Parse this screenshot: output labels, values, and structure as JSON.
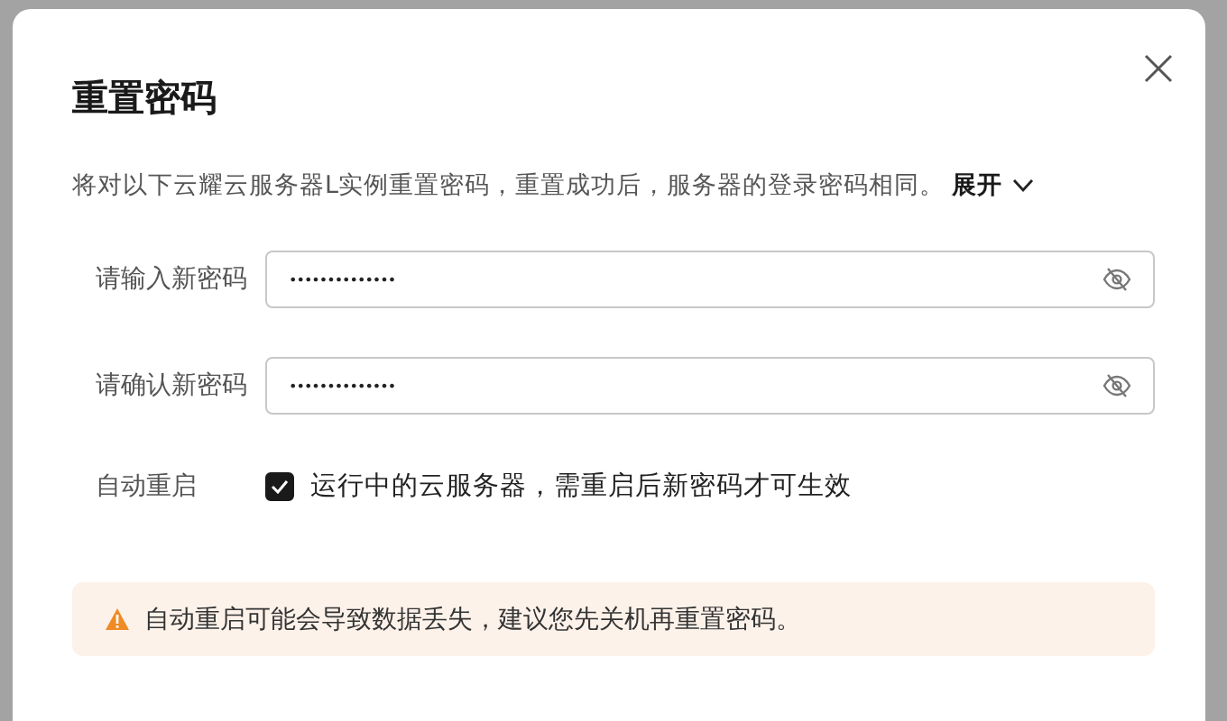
{
  "dialog": {
    "title": "重置密码",
    "description": "将对以下云耀云服务器L实例重置密码，重置成功后，服务器的登录密码相同。",
    "expand_link": "展开",
    "fields": [
      {
        "label": "请输入新密码",
        "value": "••••••••••••••"
      },
      {
        "label": "请确认新密码",
        "value": "••••••••••••••"
      }
    ],
    "auto_restart": {
      "label": "自动重启",
      "checked": true,
      "text": "运行中的云服务器，需重启后新密码才可生效"
    },
    "warning": "自动重启可能会导致数据丢失，建议您先关机再重置密码。"
  }
}
